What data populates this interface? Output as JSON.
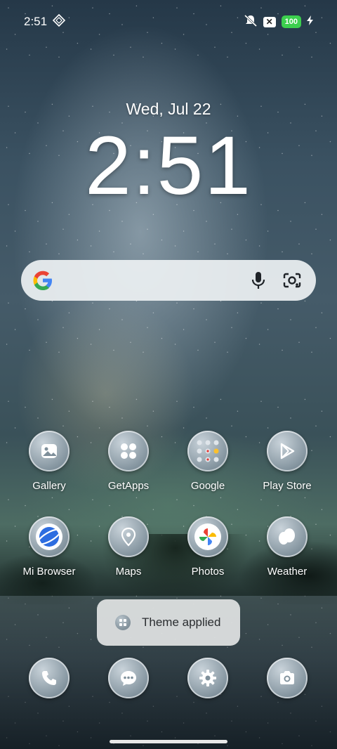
{
  "status_bar": {
    "time": "2:51",
    "battery_level": "100",
    "icons": [
      "vpn-diamond-icon",
      "mute-icon",
      "notification-x-icon",
      "charging-bolt-icon"
    ]
  },
  "lock_widget": {
    "date": "Wed, Jul 22",
    "time": "2:51"
  },
  "search": {
    "icons": [
      "google-g-icon",
      "microphone-icon",
      "google-lens-icon"
    ]
  },
  "apps_row1": [
    {
      "label": "Gallery",
      "icon": "gallery-icon"
    },
    {
      "label": "GetApps",
      "icon": "getapps-icon"
    },
    {
      "label": "Google",
      "icon": "google-folder-icon"
    },
    {
      "label": "Play Store",
      "icon": "play-store-icon"
    }
  ],
  "apps_row2": [
    {
      "label": "Mi Browser",
      "icon": "browser-icon"
    },
    {
      "label": "Maps",
      "icon": "maps-icon"
    },
    {
      "label": "Photos",
      "icon": "photos-icon"
    },
    {
      "label": "Weather",
      "icon": "weather-icon"
    }
  ],
  "toast": {
    "text": "Theme applied",
    "icon": "themes-icon"
  },
  "dock": [
    {
      "icon": "phone-icon"
    },
    {
      "icon": "messages-icon"
    },
    {
      "icon": "settings-icon"
    },
    {
      "icon": "camera-icon"
    }
  ],
  "colors": {
    "battery": "#3ccf4e",
    "search_bg": "#ecf0f2",
    "toast_bg": "#e2e4e4"
  }
}
